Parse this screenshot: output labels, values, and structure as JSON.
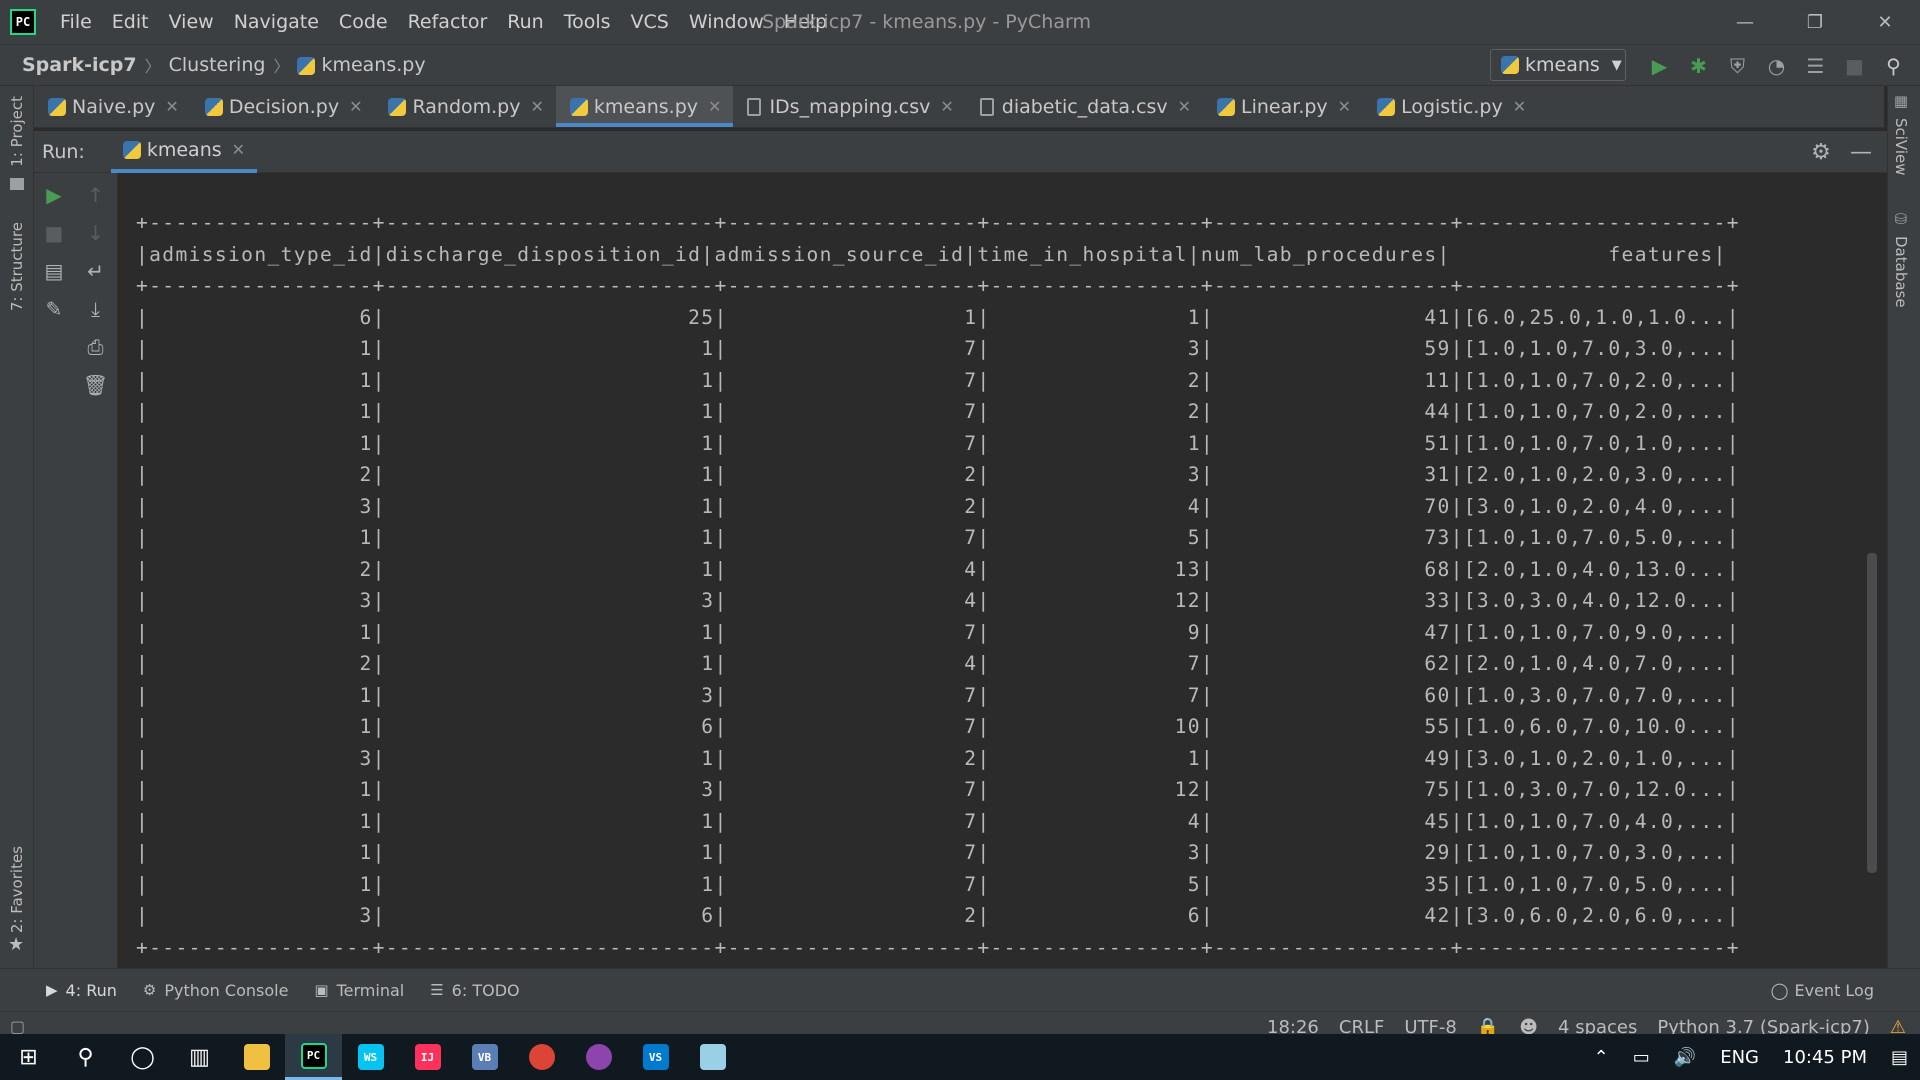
{
  "window": {
    "title": "Spark-icp7 - kmeans.py - PyCharm",
    "logo": "PC",
    "minimize": "—",
    "restore": "❐",
    "close": "✕"
  },
  "menu": [
    "File",
    "Edit",
    "View",
    "Navigate",
    "Code",
    "Refactor",
    "Run",
    "Tools",
    "VCS",
    "Window",
    "Help"
  ],
  "breadcrumb": {
    "project": "Spark-icp7",
    "folder": "Clustering",
    "file": "kmeans.py"
  },
  "run_config": {
    "name": "kmeans"
  },
  "toolbar_icons": [
    "run-icon",
    "debug-icon",
    "coverage-icon",
    "profile-icon",
    "build-icon",
    "stop-icon",
    "search-icon"
  ],
  "tabs": [
    {
      "label": "Naive.py",
      "icon": "python-icon"
    },
    {
      "label": "Decision.py",
      "icon": "python-icon"
    },
    {
      "label": "Random.py",
      "icon": "python-icon"
    },
    {
      "label": "kmeans.py",
      "icon": "python-icon",
      "active": true
    },
    {
      "label": "IDs_mapping.csv",
      "icon": "csv-icon"
    },
    {
      "label": "diabetic_data.csv",
      "icon": "csv-icon"
    },
    {
      "label": "Linear.py",
      "icon": "python-icon"
    },
    {
      "label": "Logistic.py",
      "icon": "python-icon"
    }
  ],
  "left_stripe": {
    "project": "1: Project",
    "structure": "7: Structure",
    "favorites": "2: Favorites"
  },
  "right_stripe": {
    "sciview": "SciView",
    "database": "Database"
  },
  "run_panel": {
    "label": "Run:",
    "tab": "kmeans"
  },
  "console": {
    "lines": [
      "+-----------------+-------------------------+-------------------+----------------+------------------+--------------------+",
      "|admission_type_id|discharge_disposition_id|admission_source_id|time_in_hospital|num_lab_procedures|            features|",
      "+-----------------+-------------------------+-------------------+----------------+------------------+--------------------+",
      "|                6|                       25|                  1|               1|                41|[6.0,25.0,1.0,1.0...|",
      "|                1|                        1|                  7|               3|                59|[1.0,1.0,7.0,3.0,...|",
      "|                1|                        1|                  7|               2|                11|[1.0,1.0,7.0,2.0,...|",
      "|                1|                        1|                  7|               2|                44|[1.0,1.0,7.0,2.0,...|",
      "|                1|                        1|                  7|               1|                51|[1.0,1.0,7.0,1.0,...|",
      "|                2|                        1|                  2|               3|                31|[2.0,1.0,2.0,3.0,...|",
      "|                3|                        1|                  2|               4|                70|[3.0,1.0,2.0,4.0,...|",
      "|                1|                        1|                  7|               5|                73|[1.0,1.0,7.0,5.0,...|",
      "|                2|                        1|                  4|              13|                68|[2.0,1.0,4.0,13.0...|",
      "|                3|                        3|                  4|              12|                33|[3.0,3.0,4.0,12.0...|",
      "|                1|                        1|                  7|               9|                47|[1.0,1.0,7.0,9.0,...|",
      "|                2|                        1|                  4|               7|                62|[2.0,1.0,4.0,7.0,...|",
      "|                1|                        3|                  7|               7|                60|[1.0,3.0,7.0,7.0,...|",
      "|                1|                        6|                  7|              10|                55|[1.0,6.0,7.0,10.0...|",
      "|                3|                        1|                  2|               1|                49|[3.0,1.0,2.0,1.0,...|",
      "|                1|                        3|                  7|              12|                75|[1.0,3.0,7.0,12.0...|",
      "|                1|                        1|                  7|               4|                45|[1.0,1.0,7.0,4.0,...|",
      "|                1|                        1|                  7|               3|                29|[1.0,1.0,7.0,3.0,...|",
      "|                1|                        1|                  7|               5|                35|[1.0,1.0,7.0,5.0,...|",
      "|                3|                        6|                  2|               6|                42|[3.0,6.0,2.0,6.0,...|",
      "+-----------------+-------------------------+-------------------+----------------+------------------+--------------------+"
    ]
  },
  "bottom_tools": [
    {
      "label": "4: Run",
      "icon": "run-icon",
      "active": true
    },
    {
      "label": "Python Console",
      "icon": "python-console-icon"
    },
    {
      "label": "Terminal",
      "icon": "terminal-icon"
    },
    {
      "label": "6: TODO",
      "icon": "todo-icon"
    }
  ],
  "event_log": "Event Log",
  "status": {
    "position": "18:26",
    "line_sep": "CRLF",
    "encoding": "UTF-8",
    "indent": "4 spaces",
    "interpreter": "Python 3.7 (Spark-icp7)"
  },
  "taskbar": {
    "apps": [
      "start-icon",
      "search-icon",
      "cortana-icon",
      "task-view-icon",
      "file-explorer-icon",
      "pycharm-icon",
      "webstorm-icon",
      "intellij-icon",
      "virtualbox-icon",
      "chrome-icon",
      "app-icon",
      "vscode-icon",
      "notepad-icon"
    ],
    "language": "ENG",
    "time": "10:45 PM"
  },
  "colors": {
    "accent": "#4a88c7",
    "run_green": "#499c54",
    "panel": "#3c3f41",
    "editor": "#2b2b2b"
  }
}
